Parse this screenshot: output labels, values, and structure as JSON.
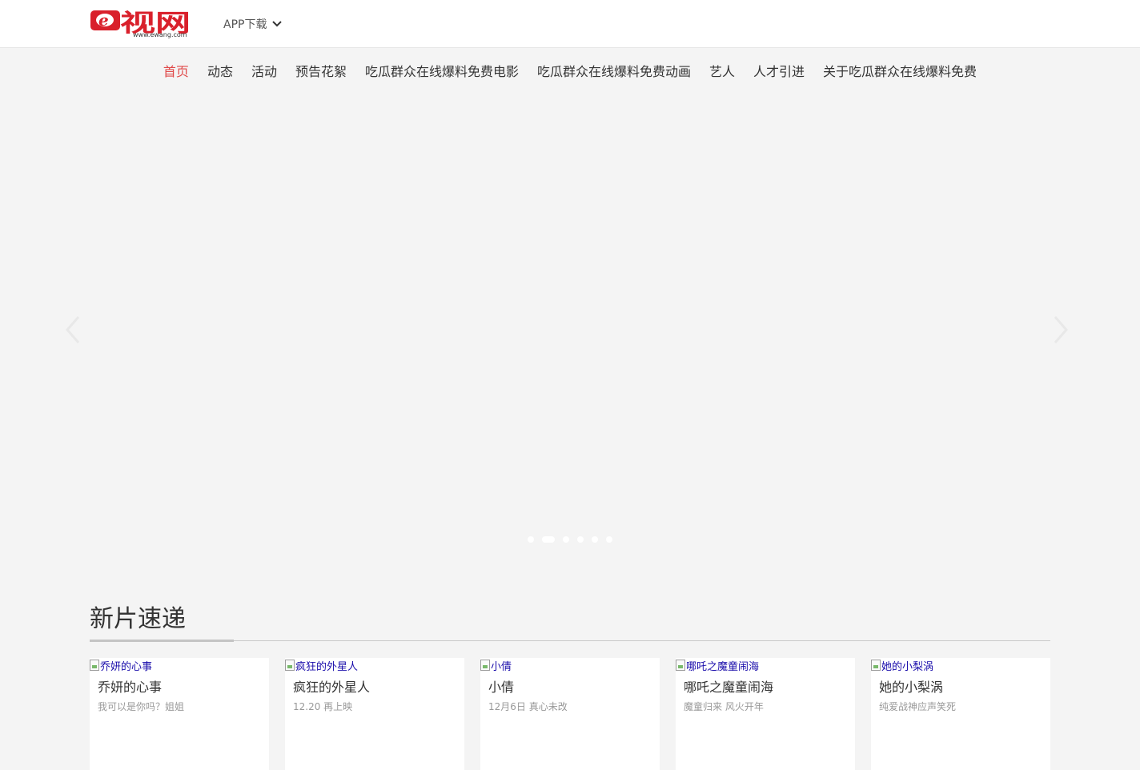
{
  "header": {
    "logo": {
      "main_text": "e视网",
      "subtext": "www.ewang.com",
      "icon": "logo-icon",
      "brand_color": "#d9202b"
    },
    "app_download_label": "APP下载",
    "app_download_icon": "chevron-down-icon"
  },
  "nav": {
    "items": [
      {
        "label": "首页",
        "active": true
      },
      {
        "label": "动态",
        "active": false
      },
      {
        "label": "活动",
        "active": false
      },
      {
        "label": "预告花絮",
        "active": false
      },
      {
        "label": "吃瓜群众在线爆料免费电影",
        "active": false
      },
      {
        "label": "吃瓜群众在线爆料免费动画",
        "active": false
      },
      {
        "label": "艺人",
        "active": false
      },
      {
        "label": "人才引进",
        "active": false
      },
      {
        "label": "关于吃瓜群众在线爆料免费",
        "active": false
      }
    ],
    "active_color": "#e04848"
  },
  "banner": {
    "prev_icon": "chevron-left-icon",
    "next_icon": "chevron-right-icon",
    "slide_count": 6,
    "active_slide": 2
  },
  "section": {
    "title": "新片速递"
  },
  "cards": [
    {
      "image_alt": "乔妍的心事",
      "title": "乔妍的心事",
      "desc": "我可以是你吗？姐姐"
    },
    {
      "image_alt": "疯狂的外星人",
      "title": "疯狂的外星人",
      "desc": "12.20 再上映"
    },
    {
      "image_alt": "小倩",
      "title": "小倩",
      "desc": "12月6日 真心未改"
    },
    {
      "image_alt": "哪吒之魔童闹海",
      "title": "哪吒之魔童闹海",
      "desc": "魔童归来 风火开年"
    },
    {
      "image_alt": "她的小梨涡",
      "title": "她的小梨涡",
      "desc": "纯爱战神应声笑死"
    }
  ]
}
